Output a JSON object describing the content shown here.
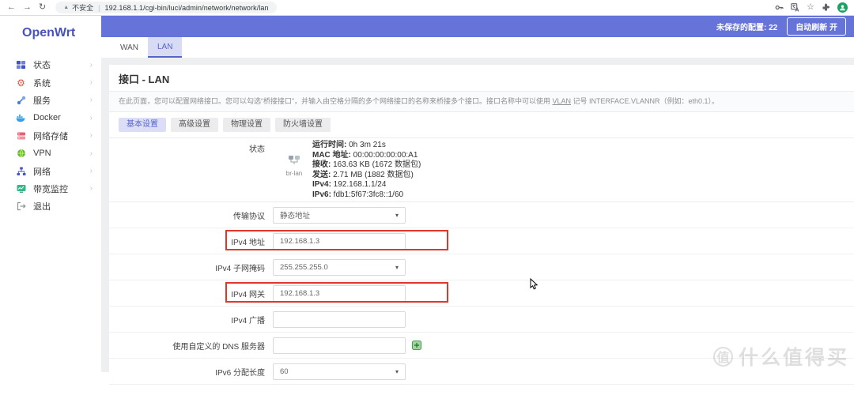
{
  "browser": {
    "url": "192.168.1.1/cgi-bin/luci/admin/network/network/lan",
    "security_label": "不安全"
  },
  "sidebar": {
    "logo": "OpenWrt",
    "items": [
      {
        "label": "状态",
        "icon": "status-grid-icon",
        "chevron": true
      },
      {
        "label": "系统",
        "icon": "system-gear-icon",
        "chevron": true
      },
      {
        "label": "服务",
        "icon": "services-icon",
        "chevron": true
      },
      {
        "label": "Docker",
        "icon": "docker-whale-icon",
        "chevron": true
      },
      {
        "label": "网络存储",
        "icon": "storage-icon",
        "chevron": true
      },
      {
        "label": "VPN",
        "icon": "vpn-globe-icon",
        "chevron": true
      },
      {
        "label": "网络",
        "icon": "network-nodes-icon",
        "chevron": true
      },
      {
        "label": "带宽监控",
        "icon": "bandwidth-monitor-icon",
        "chevron": true
      },
      {
        "label": "退出",
        "icon": "logout-icon",
        "chevron": false
      }
    ]
  },
  "header": {
    "unsaved_label": "未保存的配置: 22",
    "refresh_button": "自动刷新 开"
  },
  "tabs": [
    {
      "label": "WAN",
      "active": false
    },
    {
      "label": "LAN",
      "active": true
    }
  ],
  "page": {
    "title": "接口 - LAN",
    "description": {
      "pre": "在此页面，您可以配置网络接口。您可以勾选“桥接接口”，并输入由空格分隔的多个网络接口的名称来桥接多个接口。接口名称中可以使用 ",
      "link": "VLAN",
      "post": " 记号 INTERFACE.VLANNR（例如：eth0.1）。"
    },
    "subtabs": [
      {
        "label": "基本设置",
        "active": true
      },
      {
        "label": "高级设置",
        "active": false
      },
      {
        "label": "物理设置",
        "active": false
      },
      {
        "label": "防火墙设置",
        "active": false
      }
    ],
    "status": {
      "label": "状态",
      "device": "br-lan",
      "rows": [
        {
          "key": "运行时间:",
          "value": "0h 3m 21s"
        },
        {
          "key": "MAC 地址:",
          "value": "00:00:00:00:00:A1"
        },
        {
          "key": "接收:",
          "value": "163.63 KB (1672 数据包)"
        },
        {
          "key": "发送:",
          "value": "2.71 MB (1882 数据包)"
        },
        {
          "key": "IPv4:",
          "value": "192.168.1.1/24"
        },
        {
          "key": "IPv6:",
          "value": "fdb1:5f67:3fc8::1/60"
        }
      ]
    },
    "form": [
      {
        "label": "传输协议",
        "type": "select",
        "value": "静态地址",
        "highlight": false
      },
      {
        "label": "IPv4 地址",
        "type": "input",
        "value": "192.168.1.3",
        "highlight": true
      },
      {
        "label": "IPv4 子网掩码",
        "type": "select",
        "value": "255.255.255.0",
        "highlight": false
      },
      {
        "label": "IPv4 网关",
        "type": "input",
        "value": "192.168.1.3",
        "highlight": true
      },
      {
        "label": "IPv4 广播",
        "type": "input",
        "value": "",
        "highlight": false
      },
      {
        "label": "使用自定义的 DNS 服务器",
        "type": "input-add",
        "value": "",
        "highlight": false
      },
      {
        "label": "IPv6 分配长度",
        "type": "select",
        "value": "60",
        "highlight": false
      }
    ]
  },
  "watermark": {
    "badge": "值",
    "text": "什么值得买"
  },
  "colors": {
    "accent": "#6673d8",
    "tab_active": "#5565cd",
    "annotation_red": "#e0372a",
    "logo_blue": "#4652c3"
  }
}
